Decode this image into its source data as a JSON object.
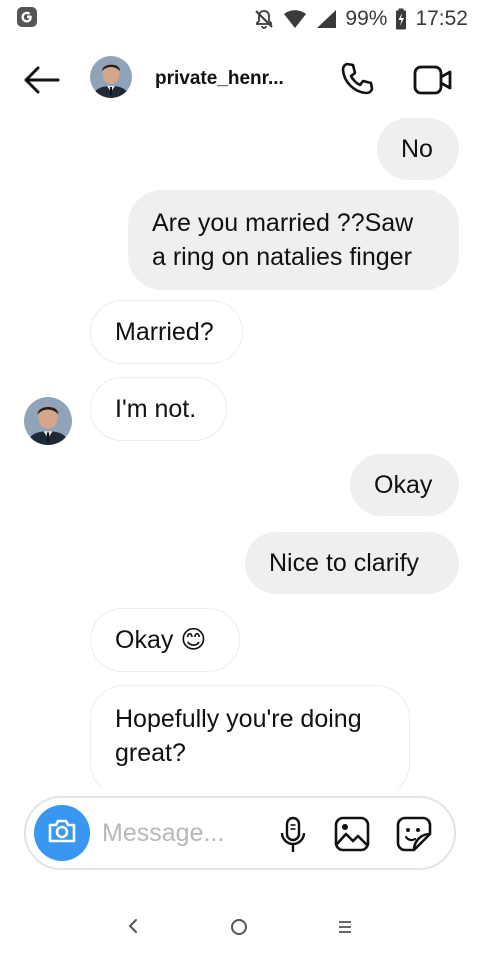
{
  "status_bar": {
    "app_icon": "google-g-icon",
    "icons": [
      "mute-bell-icon",
      "wifi-icon",
      "cell-signal-icon",
      "battery-icon"
    ],
    "battery": "99%",
    "time": "17:52"
  },
  "header": {
    "username": "private_henr...",
    "icons": [
      "back-arrow-icon",
      "avatar",
      "phone-icon",
      "video-camera-icon"
    ]
  },
  "messages": [
    {
      "side": "out",
      "text": "No"
    },
    {
      "side": "out",
      "text_lines": [
        "Are you married ??Saw",
        "a ring on natalies finger"
      ]
    },
    {
      "side": "in",
      "text": "Married?"
    },
    {
      "side": "in",
      "text": "I'm not."
    },
    {
      "side": "out",
      "text": "Okay"
    },
    {
      "side": "out",
      "text": "Nice to clarify"
    },
    {
      "side": "in",
      "text": "Okay",
      "emoji": "😊"
    },
    {
      "side": "in",
      "text_lines": [
        "Hopefully you're doing",
        "great?"
      ]
    }
  ],
  "composer": {
    "placeholder": "Message...",
    "icons": [
      "camera-icon",
      "microphone-icon",
      "gallery-icon",
      "sticker-icon"
    ]
  },
  "nav_bar": {
    "back": "‹",
    "home": "○",
    "menu": "≡"
  },
  "colors": {
    "accent": "#3897f0",
    "outgoing_bubble": "#efefef",
    "incoming_border": "#ececec"
  }
}
